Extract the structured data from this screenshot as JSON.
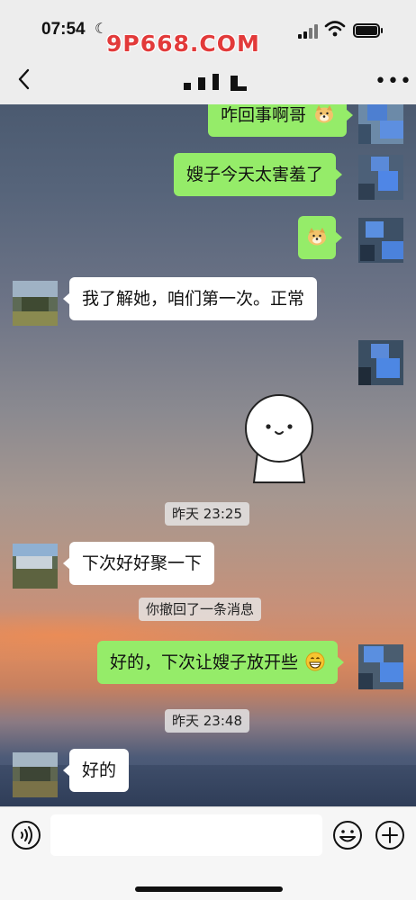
{
  "status_bar": {
    "time": "07:54",
    "watermark": "9P668.COM"
  },
  "header": {
    "back_icon": "chevron-left-icon",
    "title": "",
    "more_icon": "more-dots-icon"
  },
  "messages": [
    {
      "side": "right",
      "text": "咋回事啊哥",
      "emoji": "doge-emoji"
    },
    {
      "side": "right",
      "text": "嫂子今天太害羞了"
    },
    {
      "side": "right",
      "text": "",
      "emoji": "doge-emoji"
    },
    {
      "side": "left",
      "text": "我了解她，咱们第一次。正常"
    },
    {
      "side": "right",
      "type": "sticker",
      "sticker": "smiling-blob-sticker"
    },
    {
      "type": "time",
      "text": "昨天 23:25"
    },
    {
      "side": "left",
      "text": "下次好好聚一下"
    },
    {
      "type": "system",
      "text": "你撤回了一条消息"
    },
    {
      "side": "right",
      "text": "好的，下次让嫂子放开些",
      "emoji": "grinning-emoji"
    },
    {
      "type": "time",
      "text": "昨天 23:48"
    },
    {
      "side": "left",
      "text": "好的"
    }
  ],
  "input_bar": {
    "voice_icon": "voice-icon",
    "text_value": "",
    "emoji_icon": "emoji-icon",
    "plus_icon": "plus-icon"
  },
  "colors": {
    "outgoing_bubble": "#95ec69",
    "incoming_bubble": "#ffffff",
    "watermark": "#e23a3a"
  }
}
